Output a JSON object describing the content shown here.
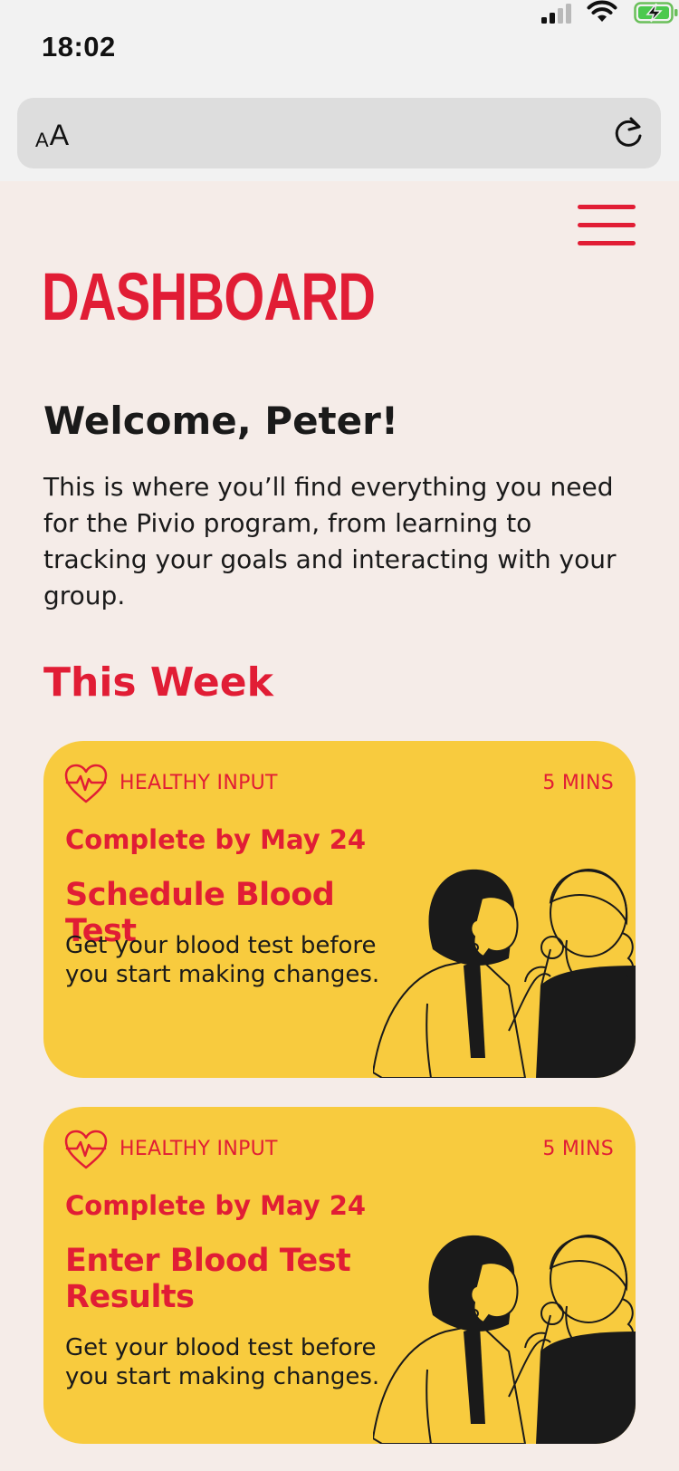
{
  "status_bar": {
    "time": "18:02",
    "icons": [
      "cellular-signal-icon",
      "wifi-icon",
      "battery-charging-icon"
    ]
  },
  "browser": {
    "text_size_small": "A",
    "text_size_large": "A",
    "reload_icon": "reload-icon"
  },
  "colors": {
    "accent": "#e11d35",
    "card": "#f8cb3e",
    "background": "#f5ece8",
    "text": "#1a1a1a"
  },
  "header": {
    "menu_icon": "hamburger-menu-icon",
    "title": "DASHBOARD"
  },
  "welcome": {
    "heading": "Welcome, Peter!",
    "body": "This is where you’ll find everything you need for the Pivio program, from learning to tracking your goals and interacting with your group."
  },
  "this_week": {
    "heading": "This Week",
    "cards": [
      {
        "icon": "heart-pulse-icon",
        "category": "HEALTHY INPUT",
        "duration": "5 MINS",
        "due": "Complete by May 24",
        "title": "Schedule Blood Test",
        "description": "Get your blood test before you start making changes.",
        "illustration": "doctor-patient-illustration"
      },
      {
        "icon": "heart-pulse-icon",
        "category": "HEALTHY INPUT",
        "duration": "5 MINS",
        "due": "Complete by May 24",
        "title": "Enter Blood Test Results",
        "description": "Get your blood test before you start making changes.",
        "illustration": "doctor-patient-illustration"
      }
    ]
  }
}
